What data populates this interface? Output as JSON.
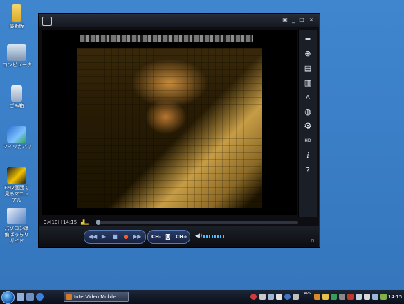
{
  "desktop": {
    "icons": [
      {
        "label": "最新版",
        "icon": "folder-icon"
      },
      {
        "label": "コンピュータ",
        "icon": "computer-icon"
      },
      {
        "label": "ごみ箱",
        "icon": "recycle-bin-icon"
      },
      {
        "label": "マイリカバリ",
        "icon": "recovery-icon"
      },
      {
        "label": "FMV画面で見るマニュアル",
        "icon": "manual-icon"
      },
      {
        "label": "パソコン準備ばっちりガイド",
        "icon": "guide-icon"
      }
    ]
  },
  "player": {
    "sidebar_buttons": [
      {
        "name": "menu-icon",
        "glyph": "≡"
      },
      {
        "name": "globe-icon",
        "glyph": "⊕"
      },
      {
        "name": "record-icon",
        "glyph": "▤"
      },
      {
        "name": "recording-list-icon",
        "glyph": "▥"
      },
      {
        "name": "caption-icon",
        "glyph": "A"
      },
      {
        "name": "chat-icon",
        "glyph": "◍"
      },
      {
        "name": "settings-icon",
        "glyph": "⚙"
      },
      {
        "name": "hd-icon",
        "glyph": "HD"
      },
      {
        "name": "info-icon",
        "glyph": "i"
      },
      {
        "name": "help-icon",
        "glyph": "?"
      }
    ],
    "status": {
      "date": "3月10日",
      "time": "14:15"
    },
    "controls": {
      "ch_down": "CH-",
      "ch_up": "CH+"
    }
  },
  "taskbar": {
    "task_label": "InterVideo Mobile...",
    "clock": "14:15",
    "tray_small_text": "CAPS"
  }
}
